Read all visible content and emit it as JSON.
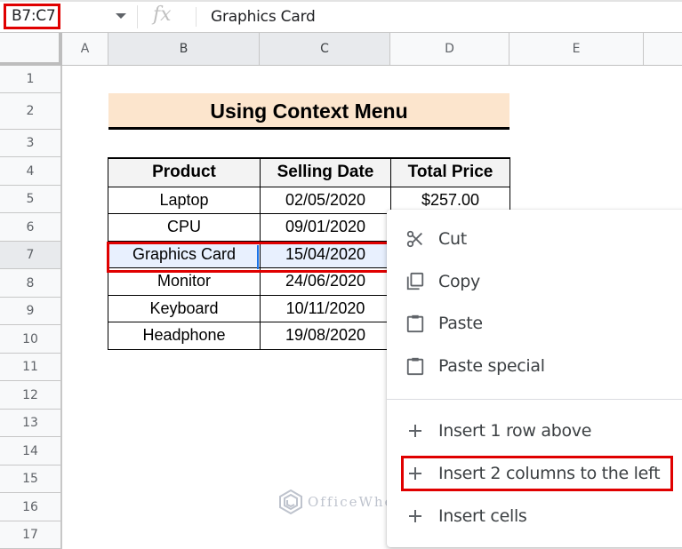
{
  "formula_bar": {
    "name_box": "B7:C7",
    "fx_label": "fx",
    "value": "Graphics Card"
  },
  "columns": [
    {
      "label": "A",
      "selected": false
    },
    {
      "label": "B",
      "selected": true
    },
    {
      "label": "C",
      "selected": true
    },
    {
      "label": "D",
      "selected": false
    },
    {
      "label": "E",
      "selected": false
    },
    {
      "label": "",
      "selected": false
    }
  ],
  "rows": [
    "1",
    "2",
    "3",
    "4",
    "5",
    "6",
    "7",
    "8",
    "9",
    "10",
    "11",
    "12",
    "13",
    "14",
    "15",
    "16",
    "17"
  ],
  "selected_row": "7",
  "sheet": {
    "title": "Using Context Menu",
    "title_fill": "#fce5cd",
    "headers": [
      "Product",
      "Selling Date",
      "Total Price"
    ],
    "data": [
      [
        "Laptop",
        "02/05/2020",
        "$257.00"
      ],
      [
        "CPU",
        "09/01/2020",
        ""
      ],
      [
        "Graphics Card",
        "15/04/2020",
        ""
      ],
      [
        "Monitor",
        "24/06/2020",
        ""
      ],
      [
        "Keyboard",
        "10/11/2020",
        ""
      ],
      [
        "Headphone",
        "19/08/2020",
        ""
      ]
    ]
  },
  "context_menu": {
    "items": [
      {
        "icon": "scissors-icon",
        "label": "Cut"
      },
      {
        "icon": "copy-icon",
        "label": "Copy"
      },
      {
        "icon": "clipboard-icon",
        "label": "Paste"
      },
      {
        "icon": "clipboard-icon",
        "label": "Paste special"
      },
      {
        "icon": "plus-icon",
        "label": "Insert 1 row above"
      },
      {
        "icon": "plus-icon",
        "label": "Insert 2 columns to the left"
      },
      {
        "icon": "plus-icon",
        "label": "Insert cells"
      }
    ],
    "highlighted_item": "Insert 2 columns to the left"
  },
  "watermark": "OfficeWheel",
  "colors": {
    "highlight_red": "#e00000",
    "selection_blue": "#1a73e8",
    "selection_fill": "#e8f0fe"
  }
}
